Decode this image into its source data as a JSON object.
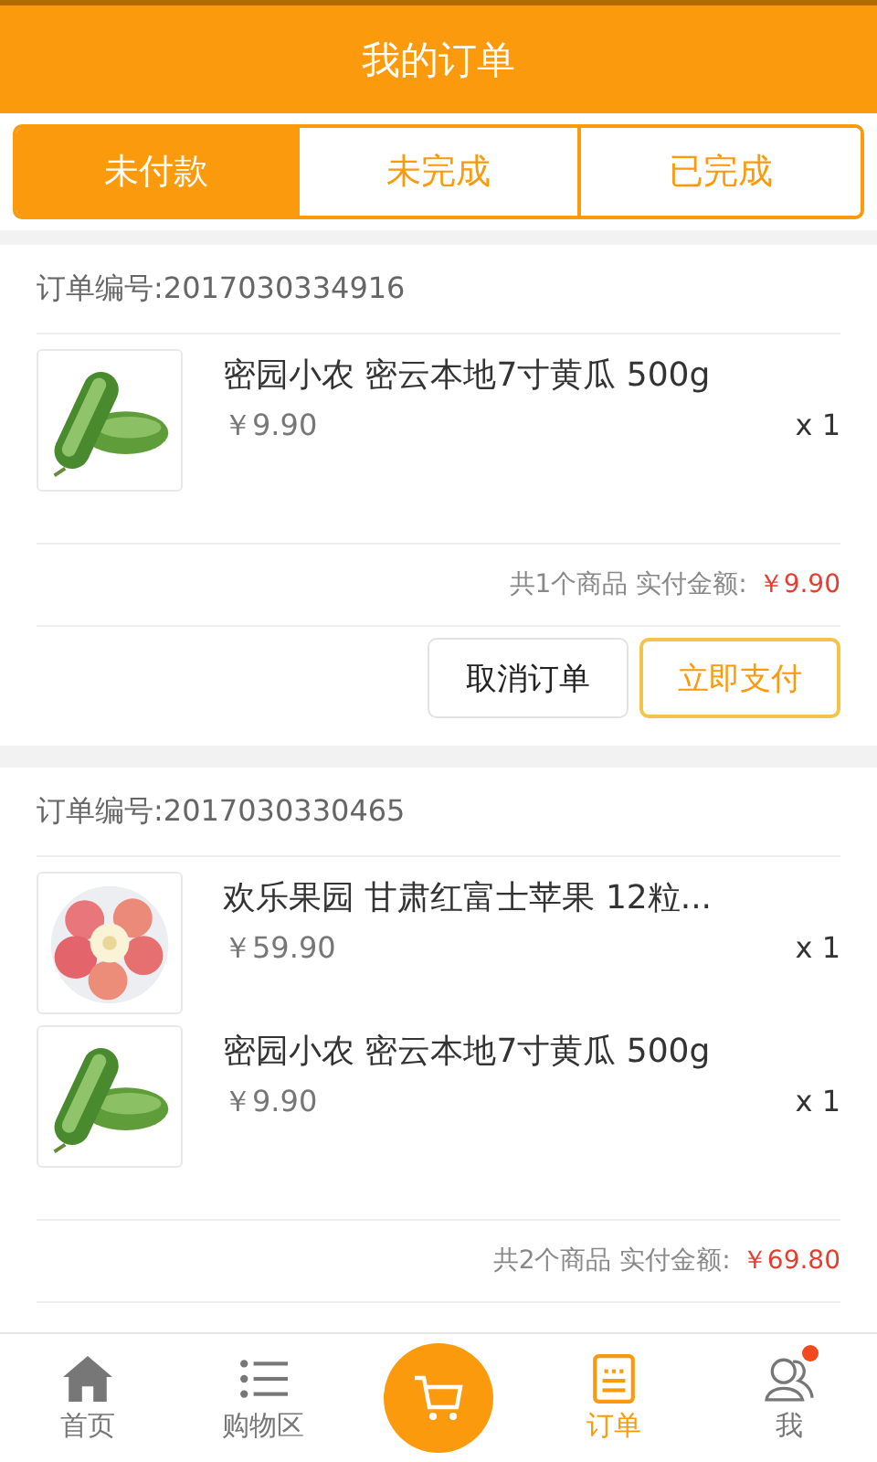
{
  "header": {
    "title": "我的订单"
  },
  "tabs": [
    {
      "label": "未付款",
      "selected": true
    },
    {
      "label": "未完成",
      "selected": false
    },
    {
      "label": "已完成",
      "selected": false
    }
  ],
  "orders": [
    {
      "number": "订单编号:2017030334916",
      "items": [
        {
          "kind": "cucumber",
          "name": "密园小农 密云本地7寸黄瓜 500g",
          "price": "￥9.90",
          "qty": "x 1"
        }
      ],
      "summary": "共1个商品 实付金额:",
      "total": "￥9.90",
      "actions": [
        {
          "label": "取消订单",
          "kind": "secondary"
        },
        {
          "label": "立即支付",
          "kind": "primary"
        }
      ]
    },
    {
      "number": "订单编号:2017030330465",
      "items": [
        {
          "kind": "apple",
          "name": "欢乐果园 甘肃红富士苹果 12粒...",
          "price": "￥59.90",
          "qty": "x 1"
        },
        {
          "kind": "cucumber",
          "name": "密园小农 密云本地7寸黄瓜 500g",
          "price": "￥9.90",
          "qty": "x 1"
        }
      ],
      "summary": "共2个商品 实付金额:",
      "total": "￥69.80"
    }
  ],
  "nav": [
    {
      "label": "首页",
      "kind": "home",
      "selected": false
    },
    {
      "label": "购物区",
      "kind": "list",
      "selected": false
    },
    {
      "kind": "cart",
      "selected": false
    },
    {
      "label": "订单",
      "kind": "order",
      "selected": true
    },
    {
      "label": "我",
      "kind": "user",
      "selected": false,
      "badge": true
    }
  ]
}
